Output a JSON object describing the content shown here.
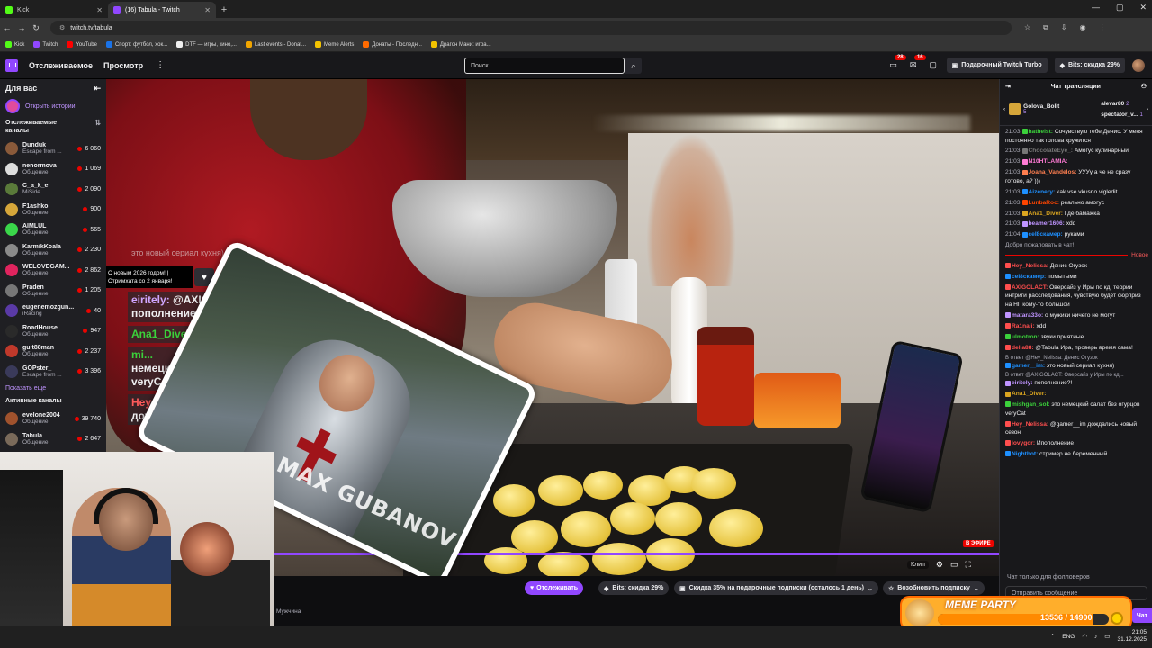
{
  "browser": {
    "tabs": [
      {
        "label": "Kick",
        "color": "#53fc18",
        "active": false
      },
      {
        "label": "(16) Tabula - Twitch",
        "color": "#9147ff",
        "active": true
      }
    ],
    "new_tab": "+",
    "url": "twitch.tv/tabula",
    "bookmarks": [
      {
        "label": "Kick",
        "color": "#53fc18"
      },
      {
        "label": "Twitch",
        "color": "#9147ff"
      },
      {
        "label": "YouTube",
        "color": "#ff0000"
      },
      {
        "label": "Спорт: футбол, хок...",
        "color": "#1a73e8"
      },
      {
        "label": "DTF — игры, кино,...",
        "color": "#eeeeee"
      },
      {
        "label": "Last events - Donat...",
        "color": "#f1a500"
      },
      {
        "label": "Meme Alerts",
        "color": "#f3c300"
      },
      {
        "label": "Донаты - Последн...",
        "color": "#ff6a00"
      },
      {
        "label": "Драгон Мани: игра...",
        "color": "#f3c300"
      }
    ]
  },
  "topnav": {
    "following": "Отслеживаемое",
    "browse": "Просмотр",
    "search_placeholder": "Поиск",
    "notif1": "28",
    "notif2": "16",
    "turbo": "Подарочный Twitch Turbo",
    "bits": "Bits: скидка 29%"
  },
  "sidebar": {
    "for_you": "Для вас",
    "stories": "Открыть истории",
    "followed_title": "Отслеживаемые каналы",
    "channels": [
      {
        "name": "Dunduk",
        "game": "Escape from ...",
        "viewers": "6 060",
        "color": "#8a5a3a"
      },
      {
        "name": "nenormova",
        "game": "Общение",
        "viewers": "1 069",
        "color": "#dddddd"
      },
      {
        "name": "C_a_k_e",
        "game": "MiSide",
        "viewers": "2 090",
        "color": "#5a7a3a"
      },
      {
        "name": "F1ashko",
        "game": "Общение",
        "viewers": "900",
        "color": "#d6a63a"
      },
      {
        "name": "AIMLUL",
        "game": "Общение",
        "viewers": "565",
        "color": "#3ad64a"
      },
      {
        "name": "KarmikKoala",
        "game": "Общение",
        "viewers": "2 230",
        "color": "#8a8a8a"
      },
      {
        "name": "WELOVEGAM...",
        "game": "Общение",
        "viewers": "2 862",
        "color": "#e0245e"
      },
      {
        "name": "Praden",
        "game": "Общение",
        "viewers": "1 205",
        "color": "#777777"
      },
      {
        "name": "eugenemozgun...",
        "game": "iRacing",
        "viewers": "40",
        "color": "#5a3aa6"
      },
      {
        "name": "RoadHouse",
        "game": "Общение",
        "viewers": "947",
        "color": "#2a2a2a"
      },
      {
        "name": "guit88man",
        "game": "Общение",
        "viewers": "2 237",
        "color": "#c0392b"
      },
      {
        "name": "GOPster_",
        "game": "Escape from ...",
        "viewers": "3 396",
        "color": "#3a3a5a"
      }
    ],
    "show_more": "Показать еще",
    "active_title": "Активные каналы",
    "active_channels": [
      {
        "name": "evelone2004",
        "game": "Общение",
        "viewers": "39 740",
        "color": "#a0522d"
      },
      {
        "name": "Tabula",
        "game": "Общение",
        "viewers": "2 647",
        "color": "#7a6a5a"
      }
    ]
  },
  "video": {
    "overlay_text": "это новый сериал кухня)",
    "ny_notice": "С новым 2026 годом! | Стримхата со 2 января!",
    "big_chat": [
      {
        "user": "eiritely:",
        "mention": "@AXIGOLACT",
        "text": "пополнение?!"
      },
      {
        "user": "Ana1_Diver",
        "text": ""
      },
      {
        "user": "mi...",
        "text": "немецкий са..."
      },
      {
        "user": "",
        "text": "veryCat"
      },
      {
        "user": "Hey...",
        "text": "дождали..."
      }
    ],
    "knight_caption": "MAX GUBANOV",
    "live": "В ЭФИРЕ",
    "clip": "Клип"
  },
  "below": {
    "streamer_game": "Мужчина",
    "follow": "Отслеживать",
    "bits": "Bits: скидка 29%",
    "subs": "Скидка 35% на подарочные подписки (осталось 1 день)",
    "resume": "Возобновить подписку"
  },
  "chat": {
    "title": "Чат трансляции",
    "gifter1": {
      "name": "Golova_Bolit",
      "count": "5"
    },
    "gifter2": {
      "name": "alevar80",
      "count": "2"
    },
    "gifter3": {
      "name": "spectator_v...",
      "count": "1"
    },
    "messages": [
      {
        "time": "21:03",
        "user": "hatheist:",
        "color": "#3bd13b",
        "text": "Сочувствую тебе Денис. У меня постоянно так голова кружится"
      },
      {
        "time": "21:03",
        "user": "ChocolateEye_:",
        "color": "#777777",
        "text": "Амогус кулинарный"
      },
      {
        "time": "21:03",
        "user": "N10HTLAMIA:",
        "color": "#ff7bd5",
        "text": ""
      },
      {
        "time": "21:03",
        "user": "Joana_Vandelos:",
        "color": "#ff7f50",
        "text": "УУУу а че не сразу готово, а? )))"
      },
      {
        "time": "21:03",
        "user": "Aizenery:",
        "color": "#1e90ff",
        "text": "kak vse vkusno vigledit"
      },
      {
        "time": "21:03",
        "user": "LunbaRoc:",
        "color": "#ff4500",
        "text": "реально амогус"
      },
      {
        "time": "21:03",
        "user": "Ana1_Diver:",
        "color": "#daa520",
        "text": "Где бамажка"
      },
      {
        "time": "21:03",
        "user": "beamer1606:",
        "color": "#bf94ff",
        "text": "xdd"
      },
      {
        "time": "21:04",
        "user": "ceI8скамер:",
        "color": "#1e90ff",
        "text": "руками"
      }
    ],
    "welcome": "Добро пожаловать в чат!",
    "new_label": "Новое",
    "messages2": [
      {
        "user": "Hey_Nelissa:",
        "color": "#ff4e4e",
        "text": "Денис Огузок"
      },
      {
        "user": "ceI8скамер:",
        "color": "#1e90ff",
        "text": "помытыми"
      },
      {
        "user": "AXIGOLACT:",
        "color": "#ff4e4e",
        "text": "Оверсайз у Иры по кд, теории интриги расследования, чувствую будет сюрприз на НГ кому-то большой"
      },
      {
        "user": "matara33o:",
        "color": "#bf94ff",
        "text": "о мужики ничего не могут"
      },
      {
        "user": "Ra1nali:",
        "color": "#ff4e4e",
        "text": "xdd"
      },
      {
        "user": "ulmotron:",
        "color": "#3bd13b",
        "text": "звуки приятные"
      },
      {
        "user": "della88:",
        "color": "#ff4e4e",
        "text": "@Tabula Ира, проверь время сама!"
      },
      {
        "reply": "В ответ @Hey_Nelissa: Денис Огузок",
        "user": "gamer__im:",
        "color": "#1e90ff",
        "text": "это новый сериал кухня)"
      },
      {
        "reply": "В ответ @AXIGOLACT: Оверсайз у Иры по кд...",
        "user": "eiritely:",
        "color": "#bf94ff",
        "text": "пополнение?!"
      },
      {
        "user": "Ana1_Diver:",
        "color": "#daa520",
        "text": ""
      },
      {
        "user": "mishgan_sol:",
        "color": "#3bd13b",
        "text": "это немецкий салат без огурцов veryCat"
      },
      {
        "user": "Hey_Nelissa:",
        "color": "#ff4e4e",
        "text": "@gamer__im дождались новый сезон"
      },
      {
        "user": "lovygor:",
        "color": "#ff4e4e",
        "text": "Ипополнение"
      },
      {
        "user": "Nightbot:",
        "color": "#1e90ff",
        "text": "стример не беременный"
      }
    ],
    "follower_only": "Чат только для фолловеров",
    "input_placeholder": "Отправить сообщение",
    "chat_btn": "Чат"
  },
  "meme": {
    "title": "MEME PARTY",
    "progress": "13536 / 14900",
    "current": 13536,
    "goal": 14900
  },
  "taskbar": {
    "lang": "ENG",
    "time": "21:05",
    "date": "31.12.2025"
  }
}
